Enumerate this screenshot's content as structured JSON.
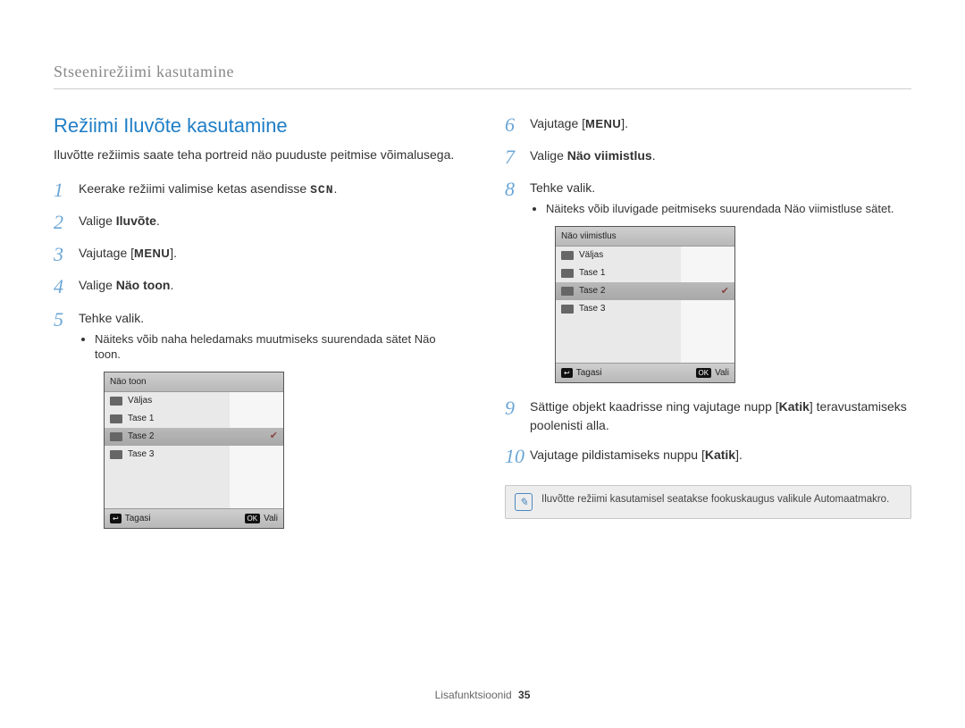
{
  "header": "Stseenirežiimi kasutamine",
  "section_title": "Režiimi Iluvõte kasutamine",
  "intro": "Iluvõtte režiimis saate teha portreid näo puuduste peitmise võimalusega.",
  "left_steps": [
    {
      "n": "1",
      "pre": "Keerake režiimi valimise ketas asendisse ",
      "scn": "SCN",
      "post": "."
    },
    {
      "n": "2",
      "pre": "Valige ",
      "bold": "Iluvõte",
      "post": "."
    },
    {
      "n": "3",
      "pre": "Vajutage [",
      "menu": "MENU",
      "post": "]."
    },
    {
      "n": "4",
      "pre": "Valige ",
      "bold": "Näo toon",
      "post": "."
    },
    {
      "n": "5",
      "pre": "Tehke valik."
    }
  ],
  "left_bullet": "Näiteks võib naha heledamaks muutmiseks suurendada sätet Näo toon.",
  "right_steps_a": [
    {
      "n": "6",
      "pre": "Vajutage [",
      "menu": "MENU",
      "post": "]."
    },
    {
      "n": "7",
      "pre": "Valige ",
      "bold": "Näo viimistlus",
      "post": "."
    },
    {
      "n": "8",
      "pre": "Tehke valik."
    }
  ],
  "right_bullet": "Näiteks võib iluvigade peitmiseks suurendada Näo viimistluse sätet.",
  "right_steps_b": [
    {
      "n": "9",
      "text_parts": [
        "Sättige objekt kaadrisse ning vajutage nupp [",
        "Katik",
        "] teravustamiseks poolenisti alla."
      ]
    },
    {
      "n": "10",
      "text_parts": [
        "Vajutage pildistamiseks nuppu [",
        "Katik",
        "]."
      ]
    }
  ],
  "note": "Iluvõtte režiimi kasutamisel seatakse fookuskaugus valikule Automaatmakro.",
  "lcd_left": {
    "title": "Näo toon",
    "rows": [
      "Väljas",
      "Tase 1",
      "Tase 2",
      "Tase 3"
    ],
    "selected_index": 2,
    "back": "Tagasi",
    "ok": "Vali"
  },
  "lcd_right": {
    "title": "Näo viimistlus",
    "rows": [
      "Väljas",
      "Tase 1",
      "Tase 2",
      "Tase 3"
    ],
    "selected_index": 2,
    "back": "Tagasi",
    "ok": "Vali"
  },
  "footer_label": "Lisafunktsioonid",
  "footer_page": "35"
}
